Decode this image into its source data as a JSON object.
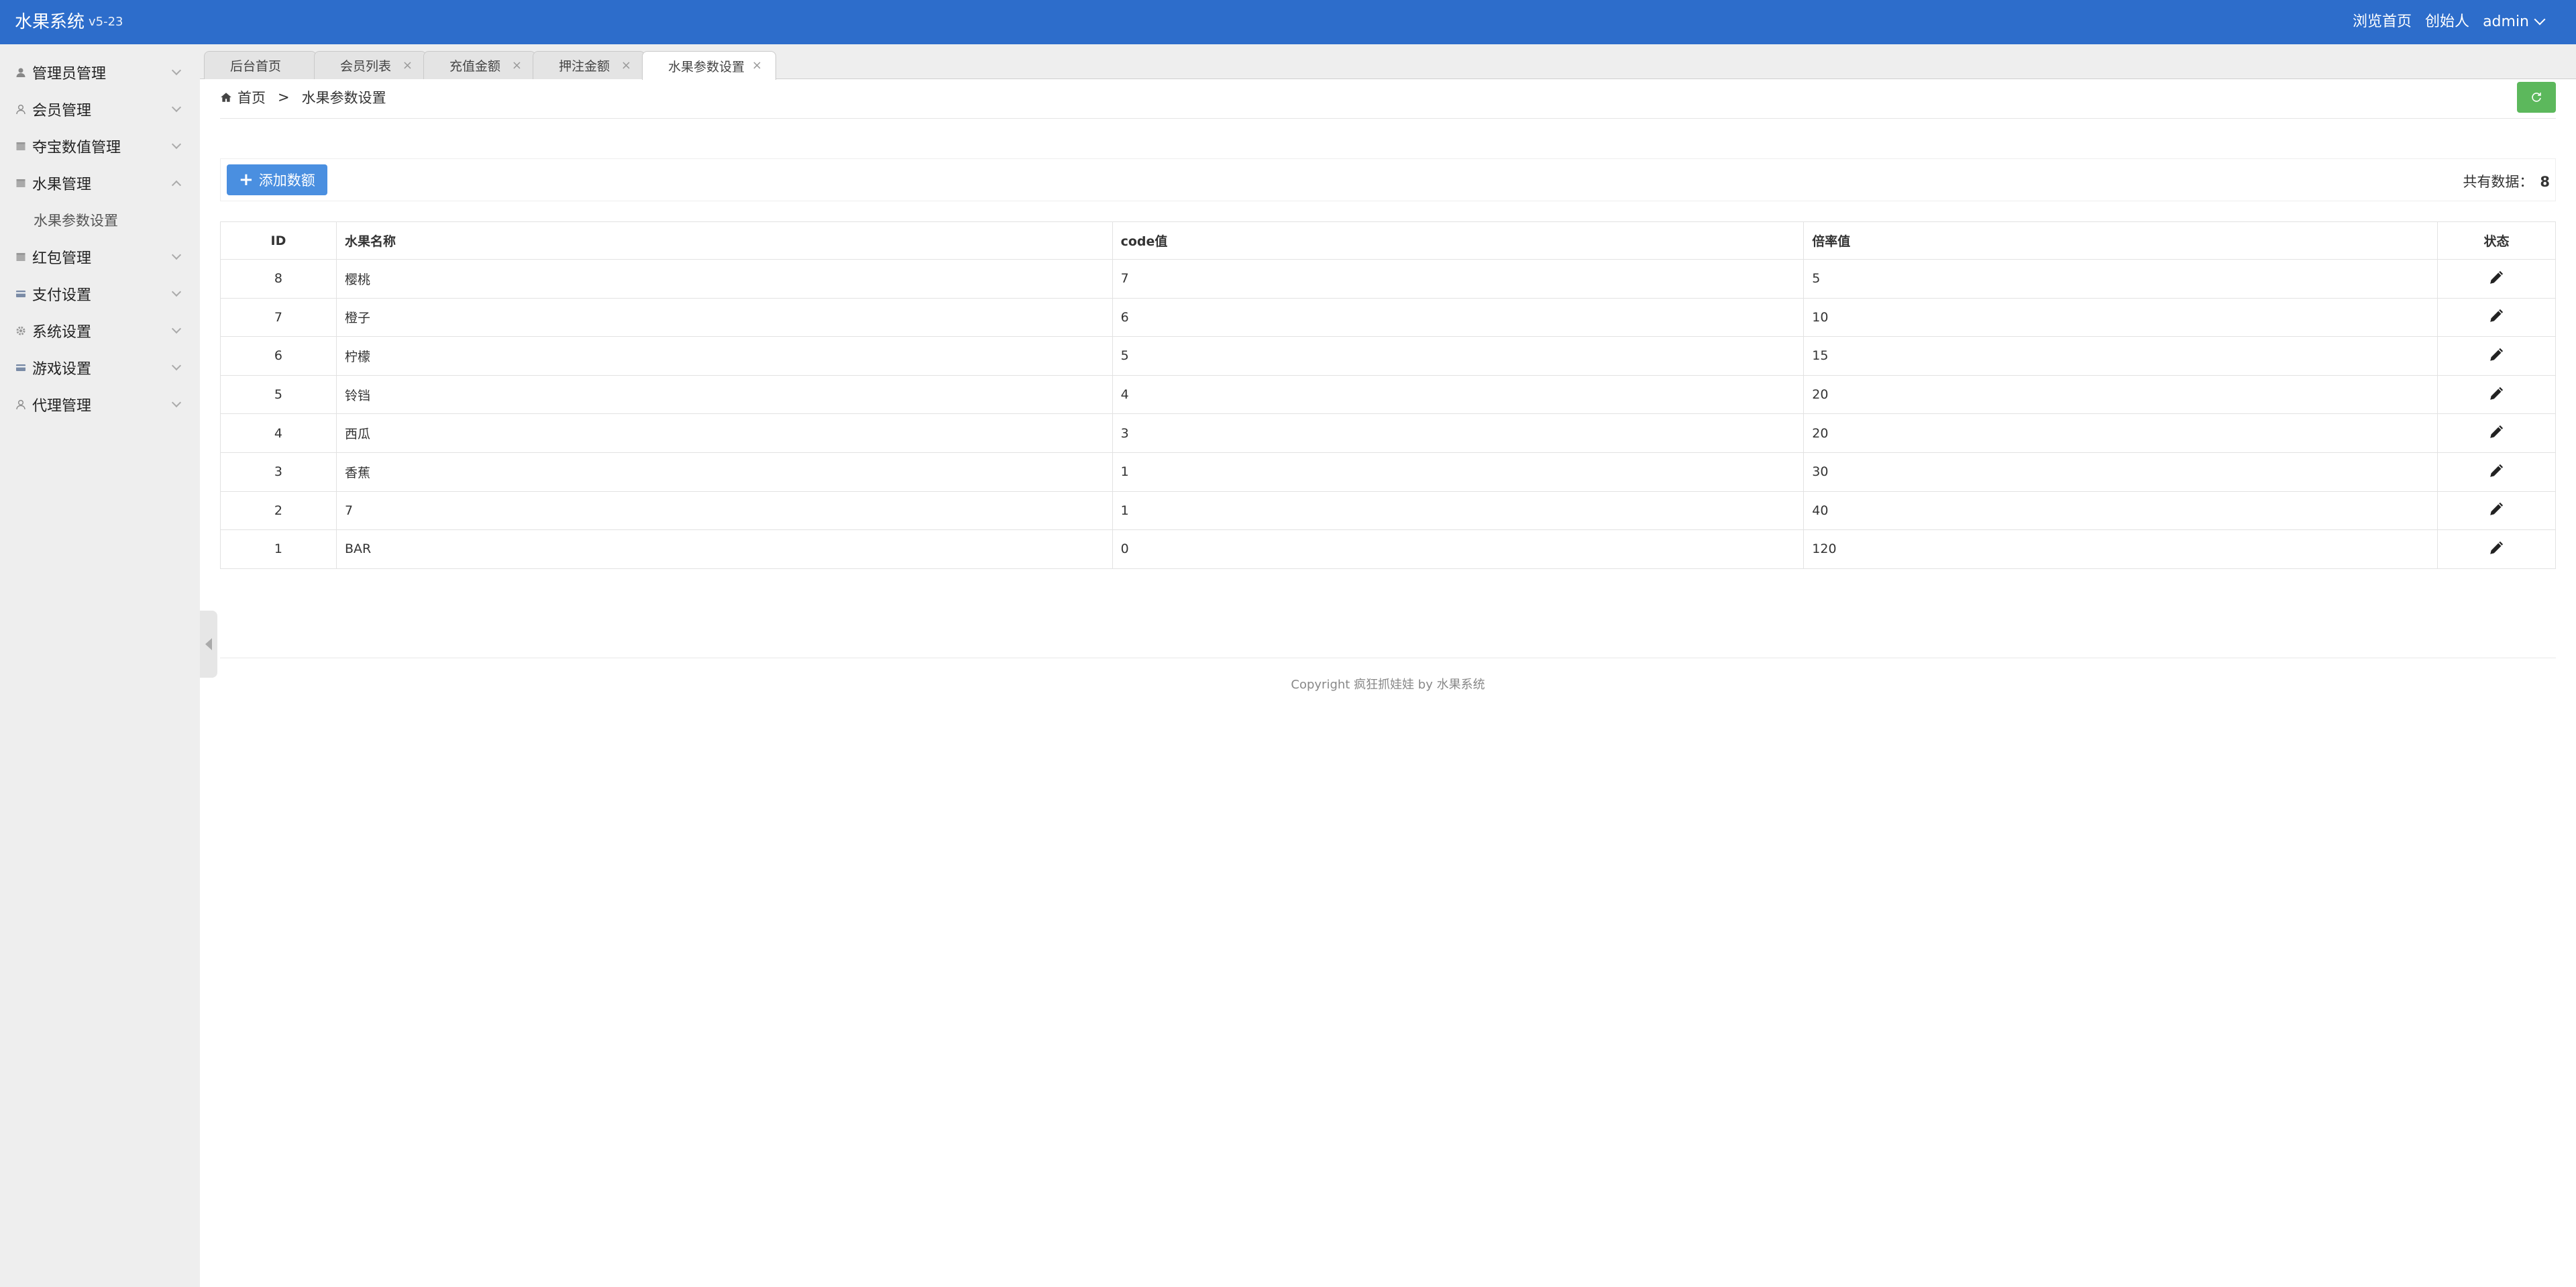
{
  "header": {
    "brand": "水果系统",
    "version": "v5-23",
    "links": [
      "浏览首页",
      "创始人",
      "admin"
    ]
  },
  "sidebar": {
    "items": [
      {
        "label": "管理员管理",
        "icon": "user-icon"
      },
      {
        "label": "会员管理",
        "icon": "user-outline-icon"
      },
      {
        "label": "夺宝数值管理",
        "icon": "box-icon"
      },
      {
        "label": "水果管理",
        "icon": "box-icon",
        "expanded": true,
        "children": [
          "水果参数设置"
        ]
      },
      {
        "label": "红包管理",
        "icon": "box-icon"
      },
      {
        "label": "支付设置",
        "icon": "card-icon"
      },
      {
        "label": "系统设置",
        "icon": "gear-icon"
      },
      {
        "label": "游戏设置",
        "icon": "card-icon"
      },
      {
        "label": "代理管理",
        "icon": "user-outline-icon"
      }
    ]
  },
  "tabs": [
    {
      "label": "后台首页",
      "closable": false
    },
    {
      "label": "会员列表",
      "closable": true
    },
    {
      "label": "充值金额",
      "closable": true
    },
    {
      "label": "押注金额",
      "closable": true
    },
    {
      "label": "水果参数设置",
      "closable": true,
      "active": true
    }
  ],
  "breadcrumb": {
    "home": "首页",
    "separator": ">",
    "current": "水果参数设置"
  },
  "toolbar": {
    "add_label": "添加数额",
    "total_label": "共有数据：",
    "total_value": "8"
  },
  "table": {
    "columns": [
      "ID",
      "水果名称",
      "code值",
      "倍率值",
      "状态"
    ],
    "rows": [
      [
        "8",
        "樱桃",
        "7",
        "5"
      ],
      [
        "7",
        "橙子",
        "6",
        "10"
      ],
      [
        "6",
        "柠檬",
        "5",
        "15"
      ],
      [
        "5",
        "铃铛",
        "4",
        "20"
      ],
      [
        "4",
        "西瓜",
        "3",
        "20"
      ],
      [
        "3",
        "香蕉",
        "1",
        "30"
      ],
      [
        "2",
        "7",
        "1",
        "40"
      ],
      [
        "1",
        "BAR",
        "0",
        "120"
      ]
    ]
  },
  "footer": {
    "text": "Copyright 疯狂抓娃娃 by 水果系统"
  },
  "colors": {
    "header": "#2d6dcb",
    "add_button": "#4a8fe0",
    "refresh_button": "#5cb85c"
  }
}
